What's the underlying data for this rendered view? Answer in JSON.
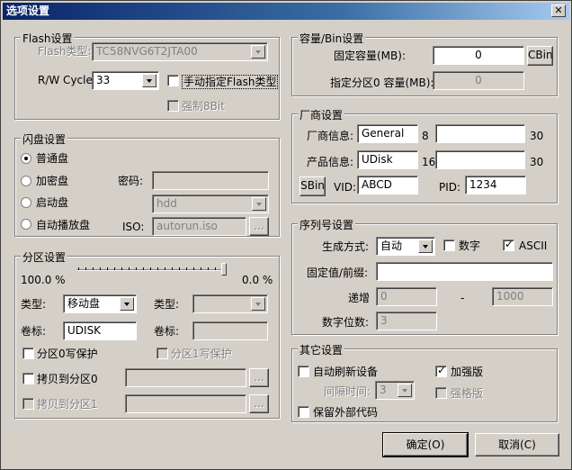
{
  "window": {
    "title": "选项设置",
    "close_label": "✕"
  },
  "flash": {
    "group": "Flash设置",
    "type_label": "Flash类型:",
    "type_value": "TC58NVG6T2JTA00",
    "rw_label": "R/W Cycle:",
    "rw_value": "33",
    "manual_label": "手动指定Flash类型",
    "manual_checked": false,
    "force_label": "强制8Bit",
    "force_checked": false
  },
  "udisk": {
    "group": "闪盘设置",
    "options": [
      "普通盘",
      "加密盘",
      "启动盘",
      "自动播放盘"
    ],
    "selected": "普通盘",
    "password_label": "密码:",
    "boot_value": "hdd",
    "iso_label": "ISO:",
    "iso_value": "autorun.iso",
    "browse_label": "..."
  },
  "partition": {
    "group": "分区设置",
    "left_percent": "100.0 %",
    "right_percent": "0.0 %",
    "split_fraction": 1.0,
    "type_label": "类型:",
    "type0_value": "移动盘",
    "type1_label": "类型:",
    "label_label": "卷标:",
    "label0_value": "UDISK",
    "label1_label": "卷标:",
    "wp0_label": "分区0写保护",
    "wp1_label": "分区1写保护",
    "copy0_label": "拷贝到分区0",
    "copy1_label": "拷贝到分区1",
    "browse_label": "..."
  },
  "capacity": {
    "group": "容量/Bin设置",
    "fixed_label": "固定容量(MB):",
    "fixed_value": "0",
    "cbin_label": "CBin",
    "part0_label": "指定分区0 容量(MB):",
    "part0_value": "0"
  },
  "vendor": {
    "group": "厂商设置",
    "vendor_label": "厂商信息:",
    "vendor_value": "General",
    "vendor_len": "8",
    "vendor_max": "30",
    "product_label": "产品信息:",
    "product_value": "UDisk",
    "product_len": "16",
    "product_max": "30",
    "sbin_label": "SBin",
    "vid_label": "VID:",
    "vid_value": "ABCD",
    "pid_label": "PID:",
    "pid_value": "1234"
  },
  "serial": {
    "group": "序列号设置",
    "mode_label": "生成方式:",
    "mode_value": "自动",
    "digit_label": "数字",
    "digit_checked": false,
    "ascii_label": "ASCII",
    "ascii_checked": true,
    "prefix_label": "固定值/前缀:",
    "inc_label": "递增",
    "inc_from": "0",
    "inc_dash": "-",
    "inc_to": "1000",
    "digits_label": "数字位数:",
    "digits_value": "3"
  },
  "other": {
    "group": "其它设置",
    "auto_refresh_label": "自动刷新设备",
    "auto_refresh_checked": false,
    "interval_label": "间隔时间:",
    "interval_value": "3",
    "enhanced_label": "加强版",
    "enhanced_checked": true,
    "strict_label": "强格版",
    "strict_checked": false,
    "keep_code_label": "保留外部代码",
    "keep_code_checked": false
  },
  "footer": {
    "ok_label": "确定(O)",
    "cancel_label": "取消(C)"
  }
}
